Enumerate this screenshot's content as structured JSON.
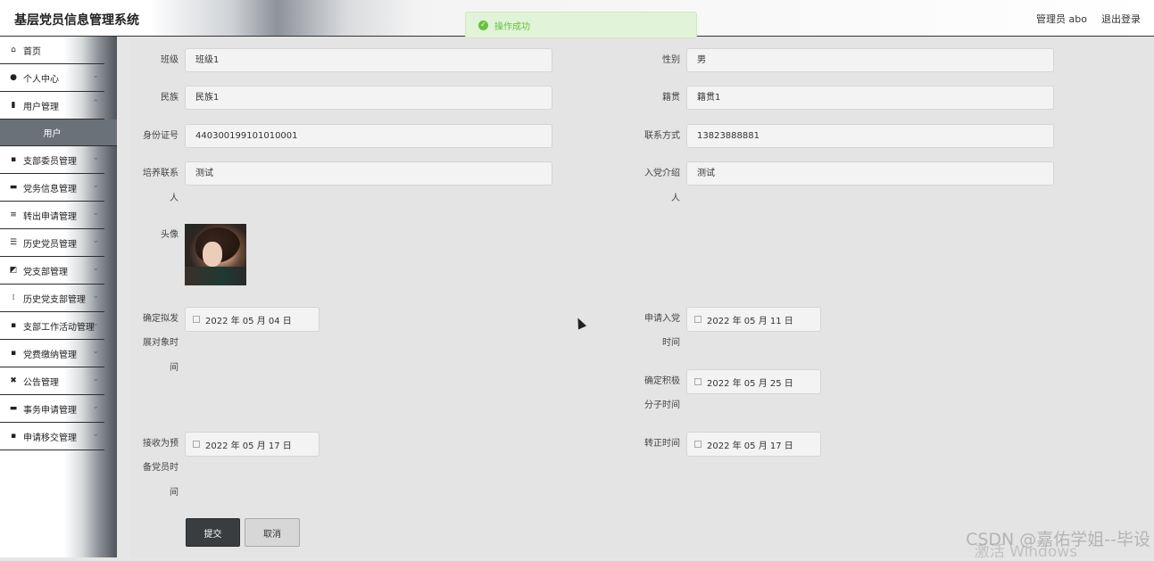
{
  "header": {
    "app_title": "基层党员信息管理系统",
    "user_info": "管理员 abo",
    "logout_label": "退出登录"
  },
  "toast": {
    "message": "操作成功"
  },
  "sidebar": {
    "items": [
      {
        "label": "首页",
        "icon": "home-icon"
      },
      {
        "label": "个人中心",
        "icon": "user-icon"
      },
      {
        "label": "用户管理",
        "icon": "bar-chart-icon"
      },
      {
        "label": "支部委员管理",
        "icon": "grid-icon"
      },
      {
        "label": "党务信息管理",
        "icon": "briefcase-icon"
      },
      {
        "label": "转出申请管理",
        "icon": "sliders-icon"
      },
      {
        "label": "历史党员管理",
        "icon": "list-icon"
      },
      {
        "label": "党支部管理",
        "icon": "chart-icon"
      },
      {
        "label": "历史党支部管理",
        "icon": "apps-icon"
      },
      {
        "label": "支部工作活动管理",
        "icon": "grid-icon"
      },
      {
        "label": "党费缴纳管理",
        "icon": "grid-icon"
      },
      {
        "label": "公告管理",
        "icon": "ticket-icon"
      },
      {
        "label": "事务申请管理",
        "icon": "card-icon"
      },
      {
        "label": "申请移交管理",
        "icon": "grid-icon"
      }
    ],
    "sub_item": "用户"
  },
  "form": {
    "class": {
      "label": "班级",
      "value": "班级1"
    },
    "gender": {
      "label": "性别",
      "value": "男"
    },
    "ethnicity": {
      "label": "民族",
      "value": "民族1"
    },
    "native_place": {
      "label": "籍贯",
      "value": "籍贯1"
    },
    "id_number": {
      "label": "身份证号",
      "value": "440300199101010001"
    },
    "phone": {
      "label": "联系方式",
      "value": "13823888881"
    },
    "trainer": {
      "label_1": "培养联系",
      "label_2": "人",
      "value": "测试"
    },
    "introducer": {
      "label_1": "入党介绍",
      "label_2": "人",
      "value": "测试"
    },
    "avatar": {
      "label": "头像"
    },
    "dev_target_date": {
      "label_1": "确定拟发",
      "label_2": "展对象时",
      "label_3": "间",
      "value": "2022 年 05 月 04 日"
    },
    "apply_date": {
      "label_1": "申请入党",
      "label_2": "时间",
      "value": "2022 年 05 月 11 日"
    },
    "activist_date": {
      "label_1": "确定积极",
      "label_2": "分子时间",
      "value": "2022 年 05 月 25 日"
    },
    "probationary_date": {
      "label_1": "接收为预",
      "label_2": "备党员时",
      "label_3": "间",
      "value": "2022 年 05 月 17 日"
    },
    "regular_date": {
      "label": "转正时间",
      "value": "2022 年 05 月 17 日"
    },
    "submit_label": "提交",
    "cancel_label": "取消"
  },
  "watermarks": {
    "csdn": "CSDN @嘉佑学姐--毕设",
    "windows": "激活 Windows"
  }
}
